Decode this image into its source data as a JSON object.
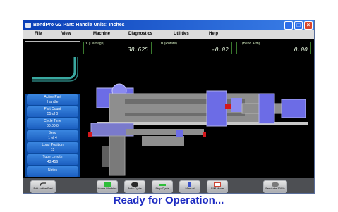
{
  "window": {
    "title": "BendPro G2  Part: Handle  Units: Inches",
    "minimize": "_",
    "maximize": "□",
    "close": "×"
  },
  "menu": [
    "File",
    "View",
    "Machine",
    "Diagnostics",
    "Utilities",
    "Help"
  ],
  "readouts": [
    {
      "label": "Y (Carriage)",
      "value": "38.625"
    },
    {
      "label": "B (Rotate)",
      "value": "-0.02"
    },
    {
      "label": "C (Bend Arm)",
      "value": "0.00"
    }
  ],
  "info_tiles": [
    {
      "label": "Active Part",
      "value": "Handle"
    },
    {
      "label": "Part Count",
      "value": "55 of 0"
    },
    {
      "label": "Cycle Time",
      "value": "00:00.0"
    },
    {
      "label": "Bend",
      "value": "1 of 4"
    },
    {
      "label": "Load Position",
      "value": "15"
    },
    {
      "label": "Tube Length",
      "value": "43.456"
    },
    {
      "label": "Notes",
      "value": ""
    }
  ],
  "toolbar": {
    "edit_active_part": "Edit Active Part",
    "home_machine": "Home Machine",
    "auto_cycle": "Auto Cycle",
    "step_cycle": "Step Cycle",
    "manual": "Manual",
    "sim_mode": "SIM Mode",
    "feedrate": "Feedrate 100%"
  },
  "status": "Ready for Operation...",
  "colors": {
    "title_bar": "#0a3fb8",
    "sidebar_tile": "#3a86e0",
    "status_text": "#1d2bc2",
    "machine_purple": "#6c6ce6",
    "machine_gray": "#8e8e8e",
    "marker_red": "#d4181c",
    "readout_border": "#3a7a2e"
  }
}
